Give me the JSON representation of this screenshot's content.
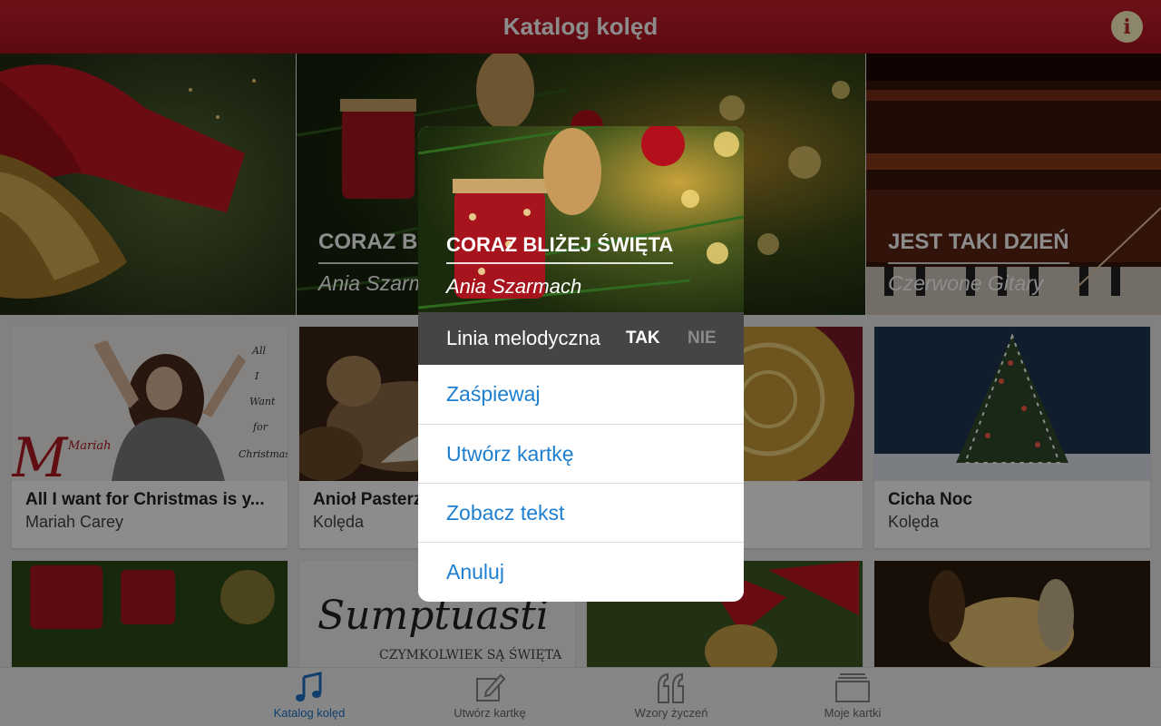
{
  "header": {
    "title": "Katalog kolęd",
    "info_label": "i"
  },
  "banner": [
    {
      "title": "",
      "subtitle": ""
    },
    {
      "title": "CORAZ BLIŻEJ ŚWIĘTA",
      "subtitle": "Ania Szarmach"
    },
    {
      "title": "JEST TAKI DZIEŃ",
      "subtitle": "Czerwone Gitary"
    }
  ],
  "cards": [
    {
      "title": "All I want for Christmas is y...",
      "subtitle": "Mariah Carey"
    },
    {
      "title": "Anioł Pasterzom Mówił",
      "subtitle": "Kolęda"
    },
    {
      "title": "",
      "subtitle": ""
    },
    {
      "title": "Cicha Noc",
      "subtitle": "Kolęda"
    }
  ],
  "cover_art": {
    "mariah_name": "Mariah",
    "mariah_lines": [
      "All",
      "I",
      "Want",
      "for",
      "Christmas"
    ],
    "sumptuasti_name": "Sumptuasti",
    "sumptuasti_sub": "CZYMKOLWIEK SĄ ŚWIĘTA"
  },
  "dialog": {
    "title": "CORAZ BLIŻEJ ŚWIĘTA",
    "artist": "Ania Szarmach",
    "melody_label": "Linia melodyczna",
    "yes": "TAK",
    "no": "NIE",
    "actions": [
      "Zaśpiewaj",
      "Utwórz kartkę",
      "Zobacz tekst",
      "Anuluj"
    ]
  },
  "tabs": [
    {
      "label": "Katalog kolęd",
      "icon": "music-note-icon",
      "active": true
    },
    {
      "label": "Utwórz kartkę",
      "icon": "edit-icon",
      "active": false
    },
    {
      "label": "Wzory życzeń",
      "icon": "quote-icon",
      "active": false
    },
    {
      "label": "Moje kartki",
      "icon": "cards-stack-icon",
      "active": false
    }
  ],
  "colors": {
    "header": "#b8192a",
    "accent": "#1e73c9",
    "link": "#1e7fd0"
  }
}
